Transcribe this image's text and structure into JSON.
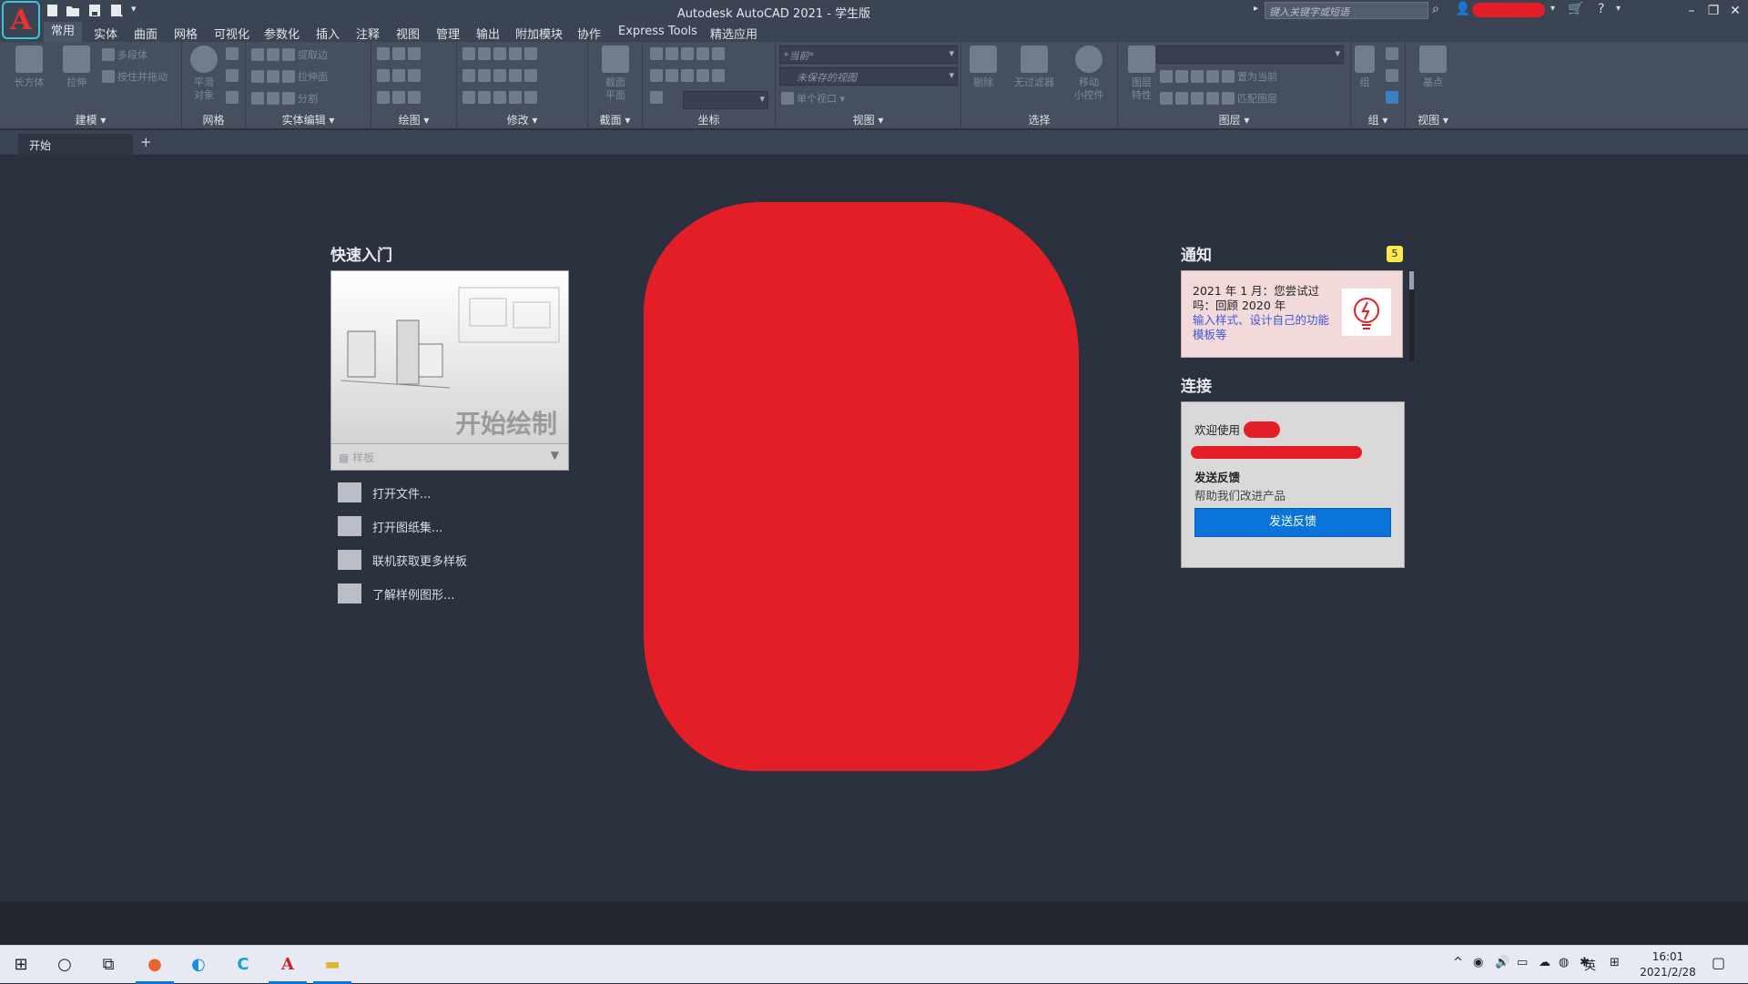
{
  "titlebar": {
    "title": "Autodesk AutoCAD 2021 - 学生版",
    "logo_letter": "A",
    "search_placeholder": "键入关键字或短语"
  },
  "ribbon_tabs": [
    "常用",
    "实体",
    "曲面",
    "网格",
    "可视化",
    "参数化",
    "插入",
    "注释",
    "视图",
    "管理",
    "输出",
    "附加模块",
    "协作",
    "Express Tools",
    "精选应用"
  ],
  "ribbon": {
    "modeling": {
      "title": "建模 ▾",
      "box": "长方体",
      "extrude": "拉伸",
      "polysolid": "多段体",
      "presspull": "按住并拖动"
    },
    "mesh": {
      "title": "网格",
      "smooth": "平滑\n对象"
    },
    "solid_edit": {
      "title": "实体编辑 ▾",
      "extract_edges": "提取边",
      "extrude_faces": "拉伸面",
      "separate": "分割"
    },
    "draw": {
      "title": "绘图 ▾"
    },
    "modify": {
      "title": "修改 ▾"
    },
    "section": {
      "title": "截面 ▾",
      "plane": "截面\n平面"
    },
    "coordinates": {
      "title": "坐标"
    },
    "view": {
      "title": "视图 ▾",
      "visual_style": "*当前*",
      "saved_view": "未保存的视图",
      "viewport": "单个视口"
    },
    "selection": {
      "title": "选择",
      "cull": "剔除",
      "no_filter": "无过滤器"
    },
    "gizmo": {
      "move": "移动\n小控件"
    },
    "layers": {
      "title": "图层 ▾",
      "properties": "图层\n特性",
      "set_current": "置为当前",
      "match": "匹配图层"
    },
    "groups": {
      "title": "组 ▾",
      "group": "组"
    },
    "view2": {
      "title": "视图 ▾",
      "base": "基点"
    }
  },
  "doc_tabs": {
    "start": "开始",
    "add": "+"
  },
  "start_page": {
    "quick_start": {
      "title": "快速入门",
      "card_title": "开始绘制",
      "template_label": "样板",
      "links": [
        "打开文件...",
        "打开图纸集...",
        "联机获取更多样板",
        "了解样例图形..."
      ]
    },
    "notifications": {
      "title": "通知",
      "badge": "5",
      "line1": "2021 年 1 月：您尝试过",
      "line2": "吗：回顾 2020 年",
      "link": "输入样式、设计自己的功能",
      "link2": "模板等"
    },
    "connect": {
      "title": "连接",
      "welcome": "欢迎使用",
      "feedback_title": "发送反馈",
      "feedback_desc": "帮助我们改进产品",
      "feedback_button": "发送反馈"
    }
  },
  "taskbar": {
    "ime": "英",
    "time": "16:01",
    "date": "2021/2/28"
  },
  "colors": {
    "redaction": "#e41e26",
    "accent": "#0a74da",
    "background": "#2b313e"
  }
}
